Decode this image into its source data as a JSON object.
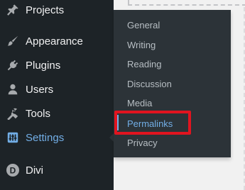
{
  "sidebar": {
    "items": [
      {
        "label": "Projects",
        "icon": "pin-icon"
      },
      {
        "label": "Appearance",
        "icon": "paintbrush-icon"
      },
      {
        "label": "Plugins",
        "icon": "plug-icon"
      },
      {
        "label": "Users",
        "icon": "user-icon"
      },
      {
        "label": "Tools",
        "icon": "wrench-icon"
      },
      {
        "label": "Settings",
        "icon": "sliders-icon"
      },
      {
        "label": "Divi",
        "icon": "divi-logo-icon"
      }
    ],
    "current": "Settings"
  },
  "settings_submenu": {
    "items": [
      {
        "label": "General"
      },
      {
        "label": "Writing"
      },
      {
        "label": "Reading"
      },
      {
        "label": "Discussion"
      },
      {
        "label": "Media"
      },
      {
        "label": "Permalinks"
      },
      {
        "label": "Privacy"
      }
    ],
    "highlighted": "Permalinks"
  },
  "colors": {
    "sidebar_bg": "#1d2327",
    "flyout_bg": "#2c3338",
    "accent": "#72aee6",
    "highlight": "#e1141f"
  }
}
